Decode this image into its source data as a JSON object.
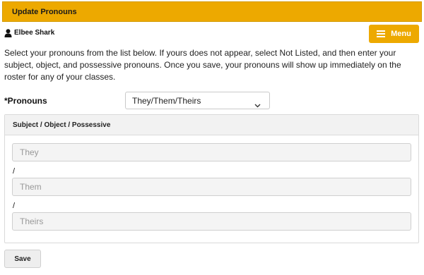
{
  "header": {
    "title": "Update Pronouns"
  },
  "user": {
    "name": "Elbee Shark",
    "icon": "user-icon"
  },
  "menu": {
    "label": "Menu",
    "icon": "hamburger-icon",
    "color": "#eda900"
  },
  "instructions": "Select your pronouns from the list below. If yours does not appear, select Not Listed, and then enter your subject, object, and possessive pronouns. Once you save, your pronouns will show up immediately on the roster for any of your classes.",
  "pronouns": {
    "label": "*Pronouns",
    "selected": "They/Them/Theirs",
    "icon": "chevron-down-icon"
  },
  "panel": {
    "heading": "Subject / Object / Possessive",
    "separator": "/",
    "subject": {
      "placeholder": "They"
    },
    "object": {
      "placeholder": "Them"
    },
    "possessive": {
      "placeholder": "Theirs"
    }
  },
  "save_label": "Save",
  "colors": {
    "accent": "#eda900",
    "panel_header": "#f2f2f2"
  }
}
